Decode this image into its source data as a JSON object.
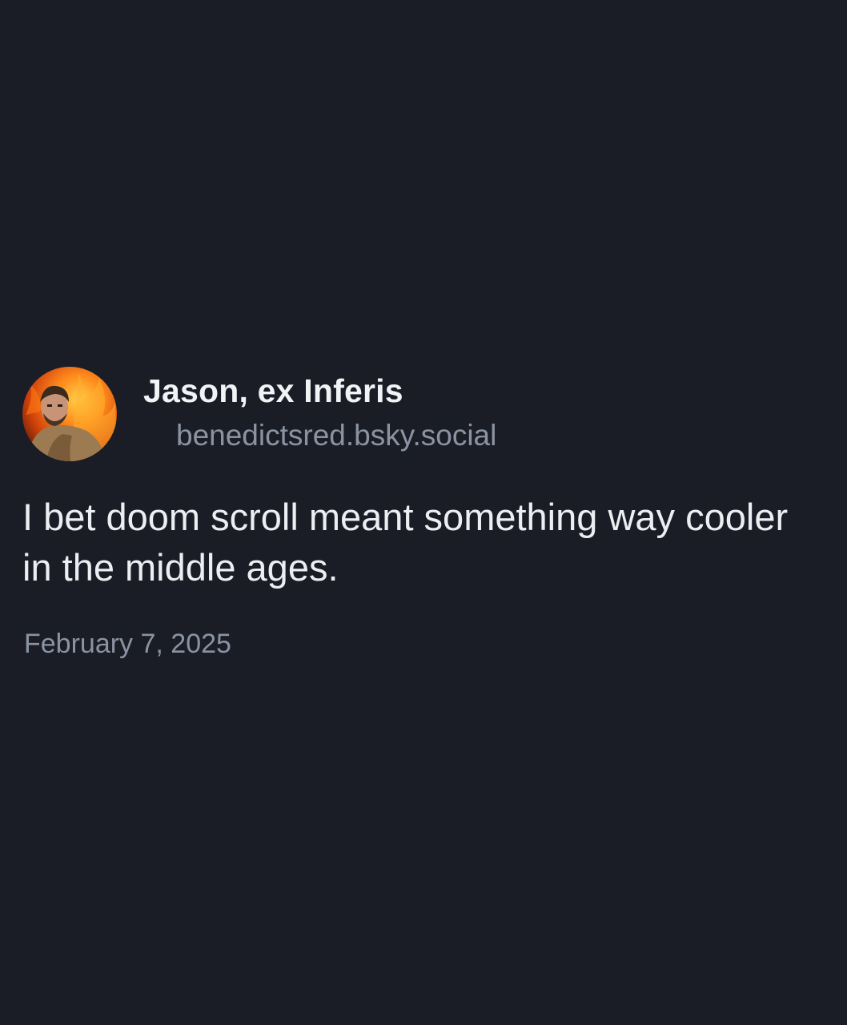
{
  "post": {
    "author": {
      "display_name": "Jason, ex Inferis",
      "handle": "benedictsred.bsky.social",
      "avatar_icon": "profile-photo-fire-background"
    },
    "text": "I bet doom scroll meant something way cooler in the middle ages.",
    "date": "February 7, 2025"
  },
  "colors": {
    "background": "#1a1d26",
    "primary_text": "#eceef2",
    "secondary_text": "#8b93a3"
  }
}
